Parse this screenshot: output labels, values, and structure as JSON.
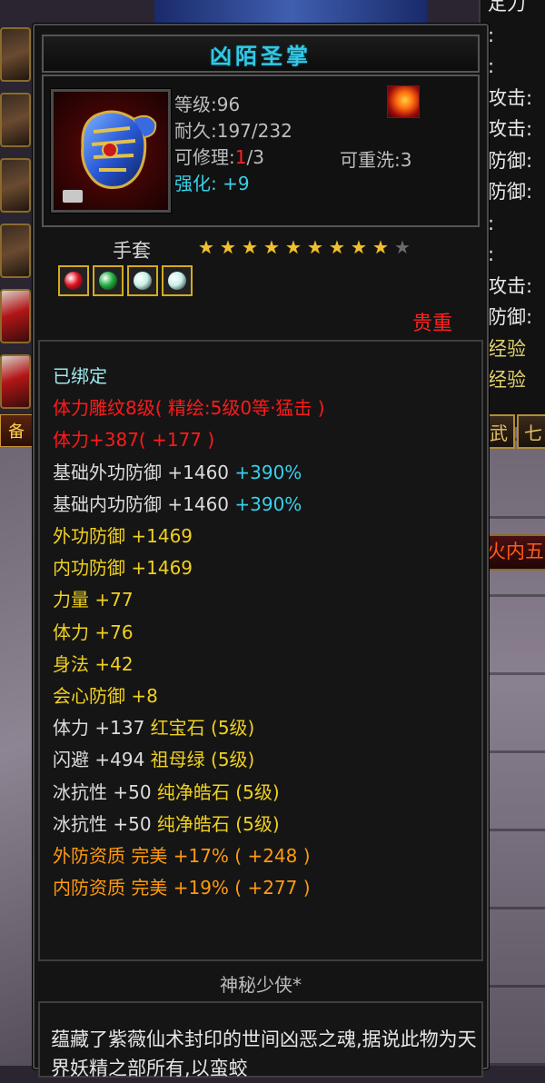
{
  "background": {
    "left_tag": "备",
    "right_panel": {
      "rows": [
        {
          "text": "定力",
          "color": "#e8e8e8"
        },
        {
          "text": ":",
          "color": "#e8e8e8"
        },
        {
          "text": ":",
          "color": "#e8e8e8"
        },
        {
          "text": "攻击:",
          "color": "#e8e8e8"
        },
        {
          "text": "攻击:",
          "color": "#e8e8e8"
        },
        {
          "text": "防御:",
          "color": "#e8e8e8"
        },
        {
          "text": "防御:",
          "color": "#e8e8e8"
        },
        {
          "text": ":",
          "color": "#e8e8e8"
        },
        {
          "text": ":",
          "color": "#e8e8e8"
        },
        {
          "text": "攻击:",
          "color": "#e8e8e8"
        },
        {
          "text": "防御:",
          "color": "#e8e8e8"
        },
        {
          "text": "经验",
          "color": "#e0d070"
        },
        {
          "text": "经验",
          "color": "#e0d070"
        }
      ],
      "btn1": "武",
      "btn2": "七",
      "fire_tab": "火内五"
    }
  },
  "tooltip": {
    "title": "凶陌圣掌",
    "level_label": "等级:96",
    "durability_label": "耐久:197/232",
    "repair_prefix": "可修理:",
    "repair_used": "1",
    "repair_suffix": "/3",
    "refine_label": "可重洗:3",
    "enhance_label": "强化:",
    "enhance_value": "+9",
    "item_type": "手套",
    "stars_total": 10,
    "stars_filled": 9,
    "gems": [
      {
        "name": "ruby",
        "color": "#e01020"
      },
      {
        "name": "emerald",
        "color": "#20b040"
      },
      {
        "name": "diamond",
        "color": "#c8f0e8"
      },
      {
        "name": "diamond",
        "color": "#c8f0e8"
      }
    ],
    "valuable_label": "贵重",
    "stats": [
      {
        "text": "已绑定",
        "cls": "c-cyan"
      },
      {
        "text": "体力雕纹8级( 精绘:5级0等·猛击 )",
        "cls": "c-red"
      },
      {
        "text": "体力+387( +177 )",
        "cls": "c-red"
      },
      {
        "text": "基础外功防御  +1460",
        "extra": "+390%",
        "cls": "c-white"
      },
      {
        "text": "基础内功防御  +1460",
        "extra": "+390%",
        "cls": "c-white"
      },
      {
        "text": "外功防御  +1469",
        "cls": "c-yellow"
      },
      {
        "text": "内功防御  +1469",
        "cls": "c-yellow"
      },
      {
        "text": "力量  +77",
        "cls": "c-yellow"
      },
      {
        "text": "体力  +76",
        "cls": "c-yellow"
      },
      {
        "text": "身法  +42",
        "cls": "c-yellow"
      },
      {
        "text": "会心防御  +8",
        "cls": "c-yellow"
      },
      {
        "text": "体力  +137",
        "gem": "红宝石 (5级)",
        "cls": "c-white"
      },
      {
        "text": "闪避  +494",
        "gem": "祖母绿 (5级)",
        "cls": "c-white"
      },
      {
        "text": "冰抗性  +50",
        "gem": "纯净皓石 (5级)",
        "cls": "c-white"
      },
      {
        "text": "冰抗性  +50",
        "gem": "纯净皓石 (5级)",
        "cls": "c-white"
      },
      {
        "text": "外防资质    完美  +17% ( +248 )",
        "cls": "c-orange"
      },
      {
        "text": "内防资质    完美  +19% ( +277 )",
        "cls": "c-orange"
      }
    ],
    "owner": "神秘少侠*",
    "description": "蕴藏了紫薇仙术封印的世间凶恶之魂,据说此物为天界妖精之部所有,以蛮蛟"
  }
}
